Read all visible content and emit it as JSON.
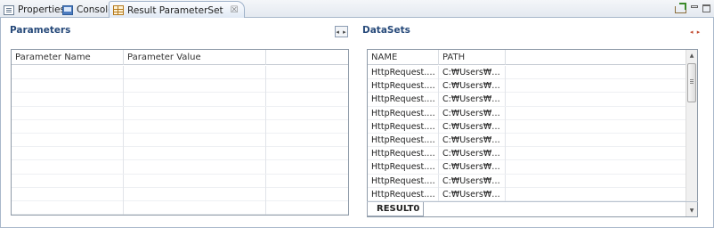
{
  "tabs": [
    {
      "label": "Properties",
      "icon": "properties-icon"
    },
    {
      "label": "Console",
      "icon": "console-icon"
    },
    {
      "label": "Result ParameterSet",
      "icon": "result-grid-icon",
      "active": true,
      "close": "☒"
    }
  ],
  "window_controls": {
    "export_icon": "export-icon",
    "minimize_icon": "minimize-icon",
    "maximize_icon": "maximize-icon"
  },
  "parameters": {
    "title": "Parameters",
    "toggle_label": "◂ ▸",
    "columns": [
      "Parameter Name",
      "Parameter Value",
      ""
    ],
    "rows": 11
  },
  "datasets": {
    "title": "DataSets",
    "toggle_label": "◂ ▸",
    "columns": [
      "NAME",
      "PATH",
      ""
    ],
    "rows": [
      {
        "name": "HttpRequest.xml",
        "path": "C:₩Users₩gan..."
      },
      {
        "name": "HttpRequest.xml",
        "path": "C:₩Users₩gan..."
      },
      {
        "name": "HttpRequest.xml",
        "path": "C:₩Users₩gan..."
      },
      {
        "name": "HttpRequest.xml",
        "path": "C:₩Users₩gan..."
      },
      {
        "name": "HttpRequest.xml",
        "path": "C:₩Users₩gan..."
      },
      {
        "name": "HttpRequest.xml",
        "path": "C:₩Users₩gan..."
      },
      {
        "name": "HttpRequest.xml",
        "path": "C:₩Users₩gan..."
      },
      {
        "name": "HttpRequest.xml",
        "path": "C:₩Users₩gan..."
      },
      {
        "name": "HttpRequest.xml",
        "path": "C:₩Users₩gan..."
      },
      {
        "name": "HttpRequest.xml",
        "path": "C:₩Users₩gan..."
      }
    ],
    "result_tab": "RESULT0"
  },
  "colors": {
    "section_title": "#274a7a",
    "accent_arrows": "#c24a2f",
    "border": "#a9b8cb"
  }
}
